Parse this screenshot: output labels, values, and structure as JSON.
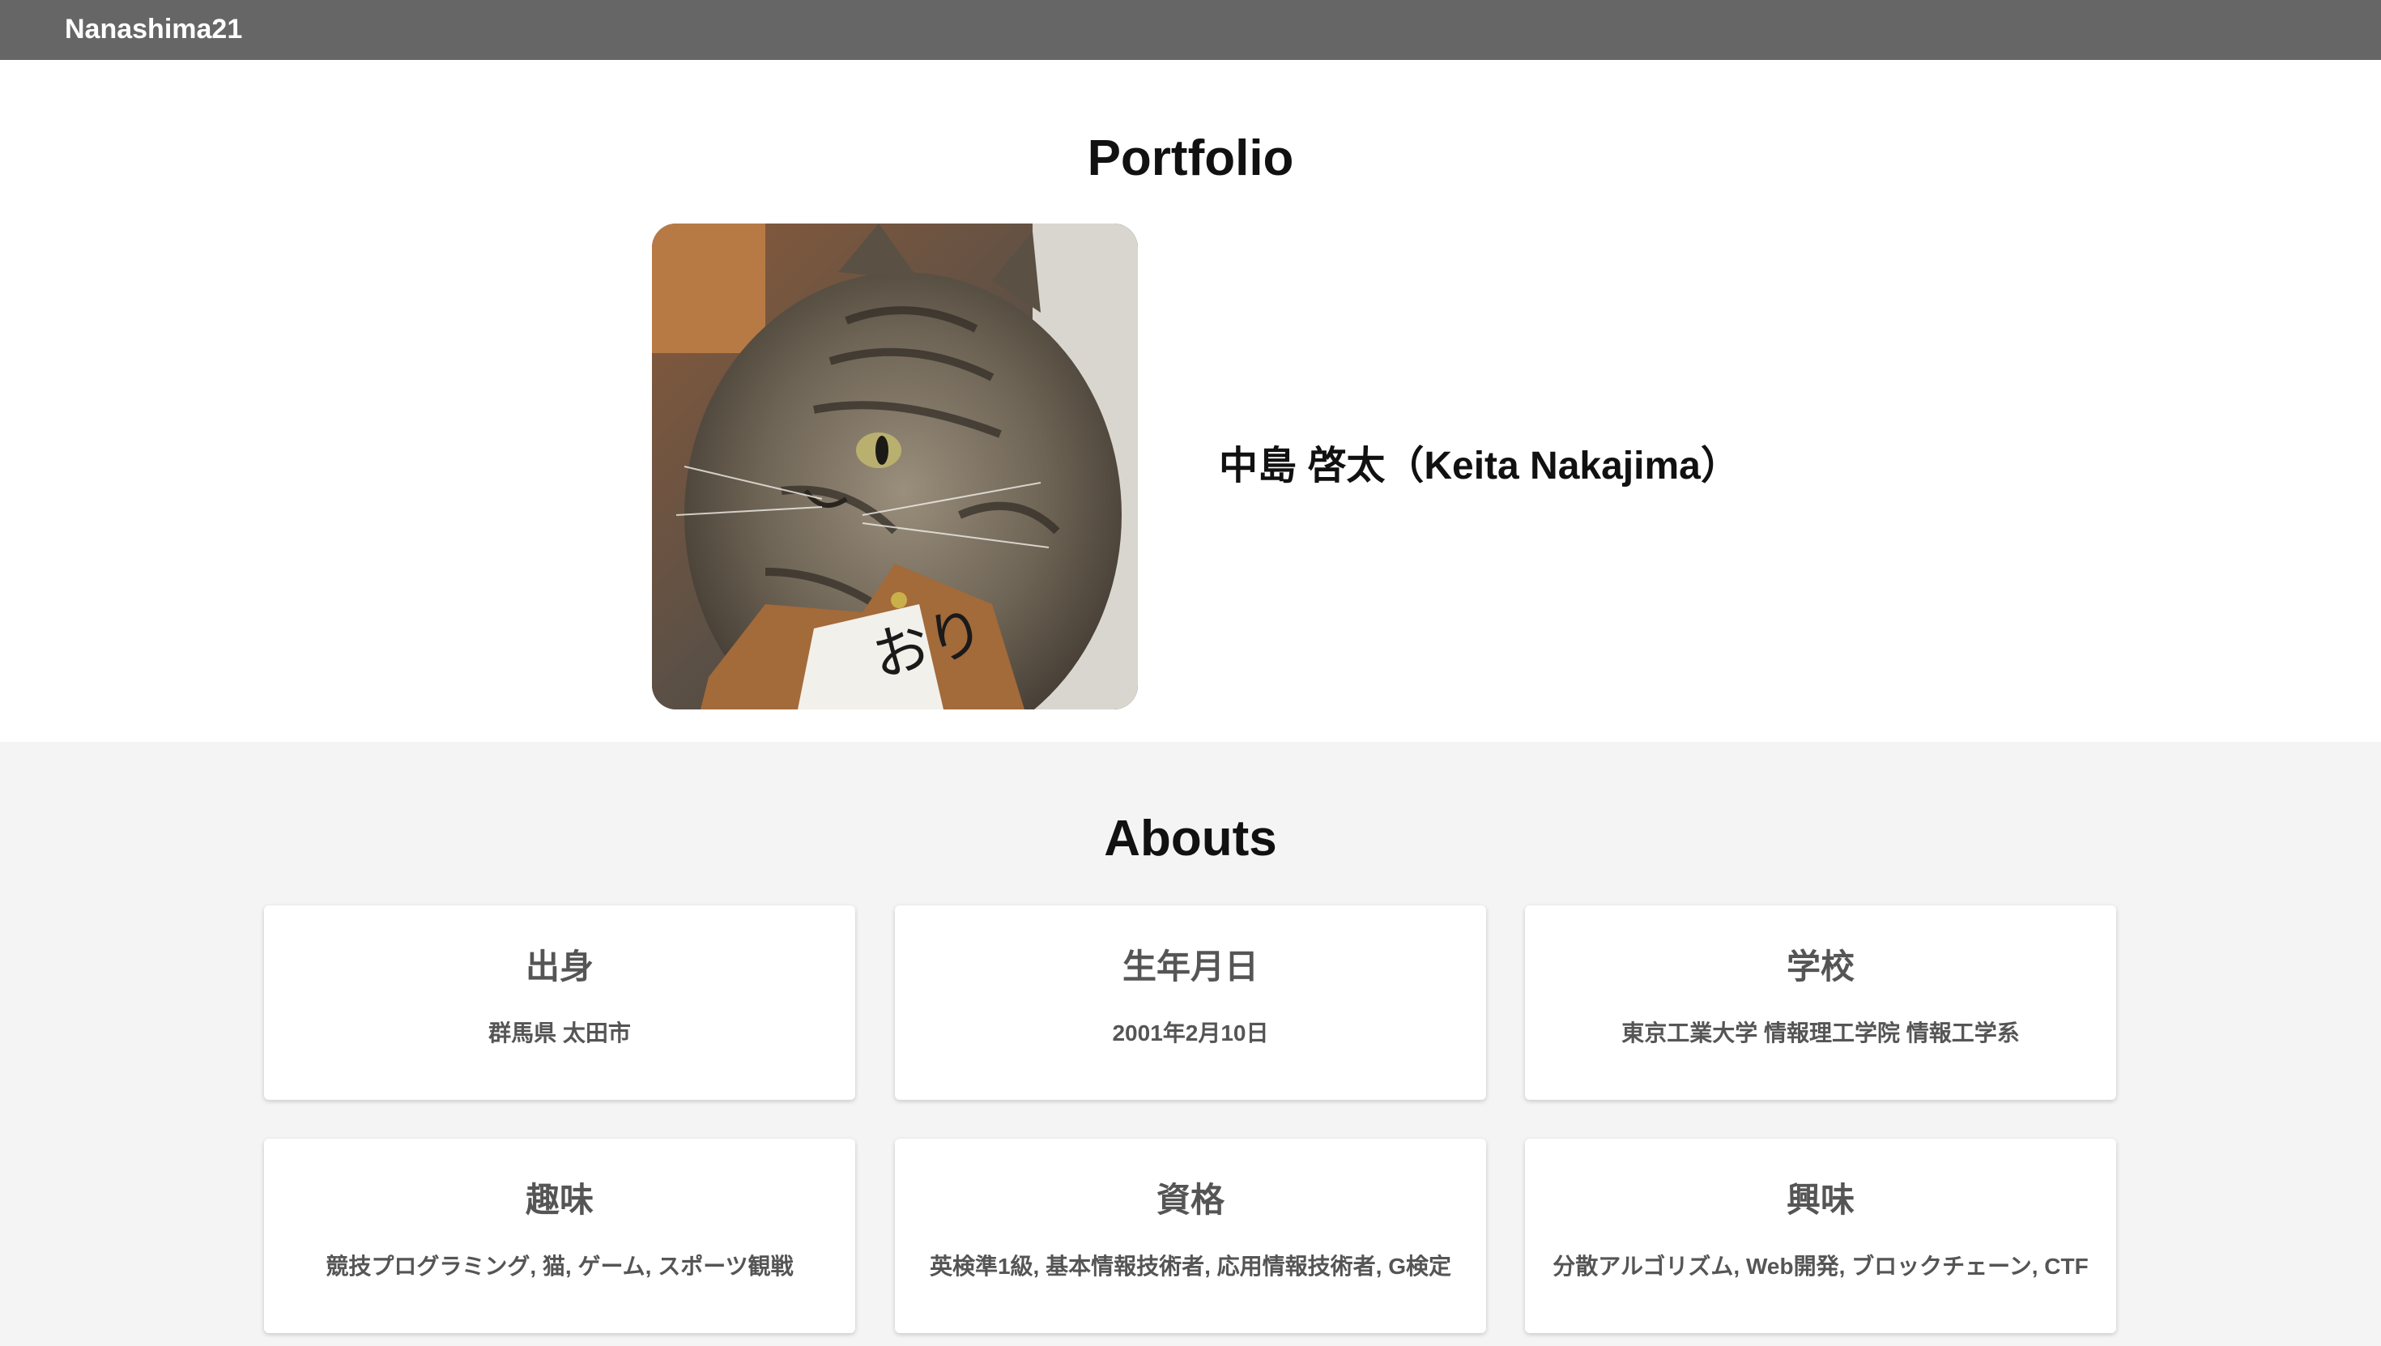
{
  "header": {
    "brand": "Nanashima21",
    "bar_color": "#666666"
  },
  "hero": {
    "title": "Portfolio",
    "avatar_icon": "cat-photo",
    "name": "中島 啓太（Keita Nakajima）"
  },
  "abouts": {
    "title": "Abouts",
    "background": "#f4f4f4",
    "cards": [
      {
        "title": "出身",
        "text": "群馬県 太田市"
      },
      {
        "title": "生年月日",
        "text": "2001年2月10日"
      },
      {
        "title": "学校",
        "text": "東京工業大学 情報理工学院 情報工学系"
      },
      {
        "title": "趣味",
        "text": "競技プログラミング, 猫, ゲーム, スポーツ観戦"
      },
      {
        "title": "資格",
        "text": "英検準1級, 基本情報技術者, 応用情報技術者, G検定"
      },
      {
        "title": "興味",
        "text": "分散アルゴリズム, Web開発, ブロックチェーン, CTF"
      }
    ]
  }
}
